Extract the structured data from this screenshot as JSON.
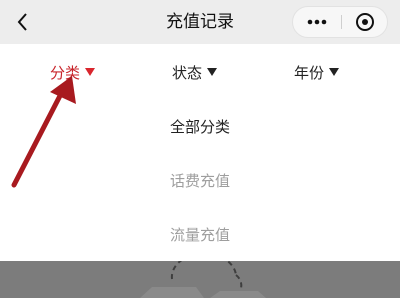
{
  "header": {
    "title": "充值记录"
  },
  "filters": {
    "category": "分类",
    "status": "状态",
    "year": "年份"
  },
  "options": {
    "all": "全部分类",
    "phone": "话费充值",
    "data": "流量充值"
  },
  "colors": {
    "accent": "#c8252b",
    "arrow": "#a81a1f",
    "header_bg": "#ededed",
    "muted_text": "#9e9e9e",
    "overlay": "#7c7c7c"
  },
  "icons": {
    "back": "chevron-left-icon",
    "more": "more-dots-icon",
    "close": "close-circle-icon",
    "dropdown": "triangle-down-icon",
    "empty": "empty-state-icon",
    "annotation": "red-arrow-annotation"
  }
}
